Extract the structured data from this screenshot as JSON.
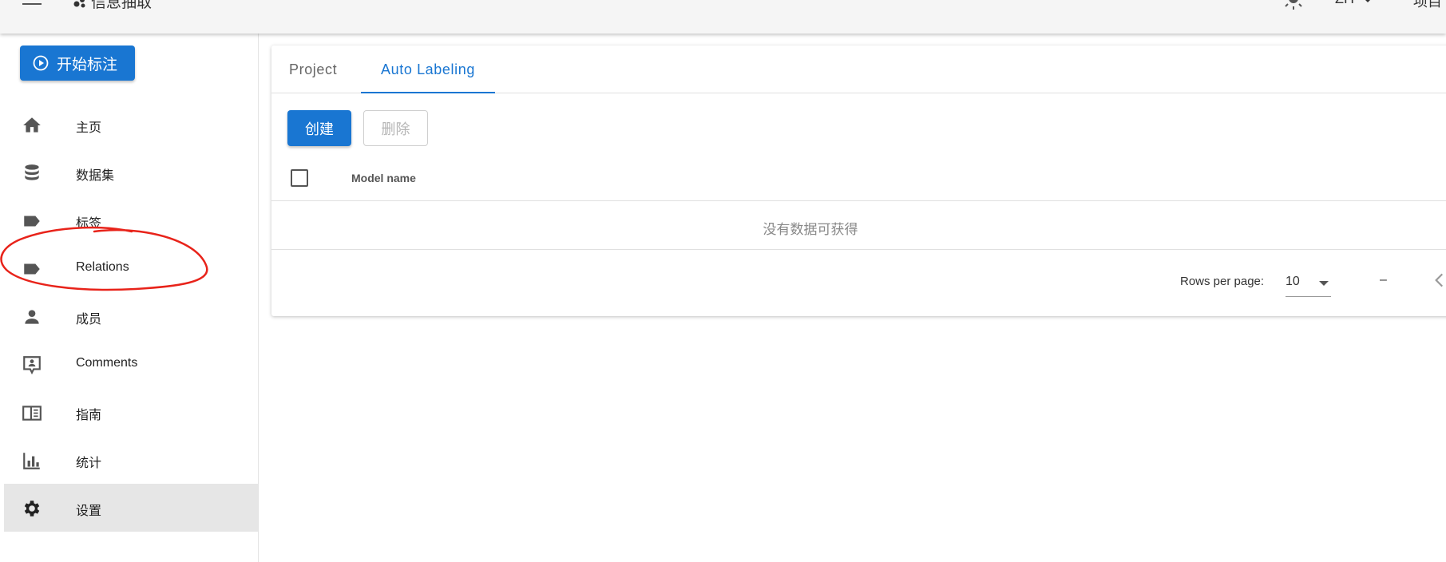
{
  "appbar": {
    "title": "信息抽取",
    "language": "ZH",
    "projects_label": "项目"
  },
  "sidebar": {
    "start_button": "开始标注",
    "items": [
      {
        "label": "主页",
        "icon": "home-icon"
      },
      {
        "label": "数据集",
        "icon": "database-icon"
      },
      {
        "label": "标签",
        "icon": "label-icon"
      },
      {
        "label": "Relations",
        "icon": "label-icon"
      },
      {
        "label": "成员",
        "icon": "person-icon"
      },
      {
        "label": "Comments",
        "icon": "comment-account-icon"
      },
      {
        "label": "指南",
        "icon": "book-icon"
      },
      {
        "label": "统计",
        "icon": "chart-bar-icon"
      },
      {
        "label": "设置",
        "icon": "gear-icon",
        "active": true
      }
    ]
  },
  "main": {
    "tabs": [
      {
        "label": "Project"
      },
      {
        "label": "Auto Labeling",
        "active": true
      }
    ],
    "create_button": "创建",
    "delete_button": "删除",
    "table": {
      "columns": [
        "Model name"
      ],
      "empty_text": "没有数据可获得"
    },
    "pager": {
      "rows_per_page_label": "Rows per page:",
      "rows_per_page": "10",
      "range": "–"
    }
  },
  "colors": {
    "primary": "#1976d2",
    "active_nav_bg": "#e6e6e6",
    "annotation": "#e8231a"
  }
}
